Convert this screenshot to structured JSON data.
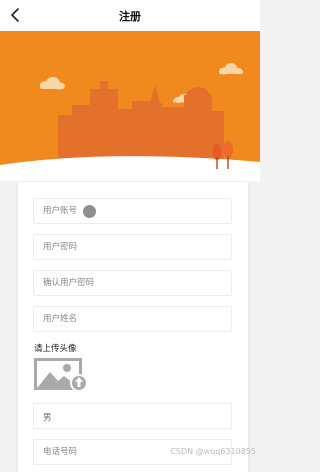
{
  "header": {
    "title": "注册",
    "back_icon": "chevron-left-icon"
  },
  "banner": {
    "colors": {
      "background": "#f08a1e",
      "buildings": "#e06a2a",
      "ground": "#ffffff"
    },
    "icons": [
      "cloud-icon",
      "cloud-icon",
      "cloud-icon",
      "tree-icon"
    ]
  },
  "form": {
    "account": {
      "placeholder": "用户账号"
    },
    "password": {
      "placeholder": "用户密码"
    },
    "confirm_password": {
      "placeholder": "确认用户密码"
    },
    "name": {
      "placeholder": "用户姓名"
    },
    "avatar": {
      "label": "请上传头像",
      "icon": "image-upload-icon"
    },
    "gender": {
      "value": "男"
    },
    "phone": {
      "placeholder": "电话号码"
    }
  },
  "watermark": "CSDN @wqq6310855"
}
